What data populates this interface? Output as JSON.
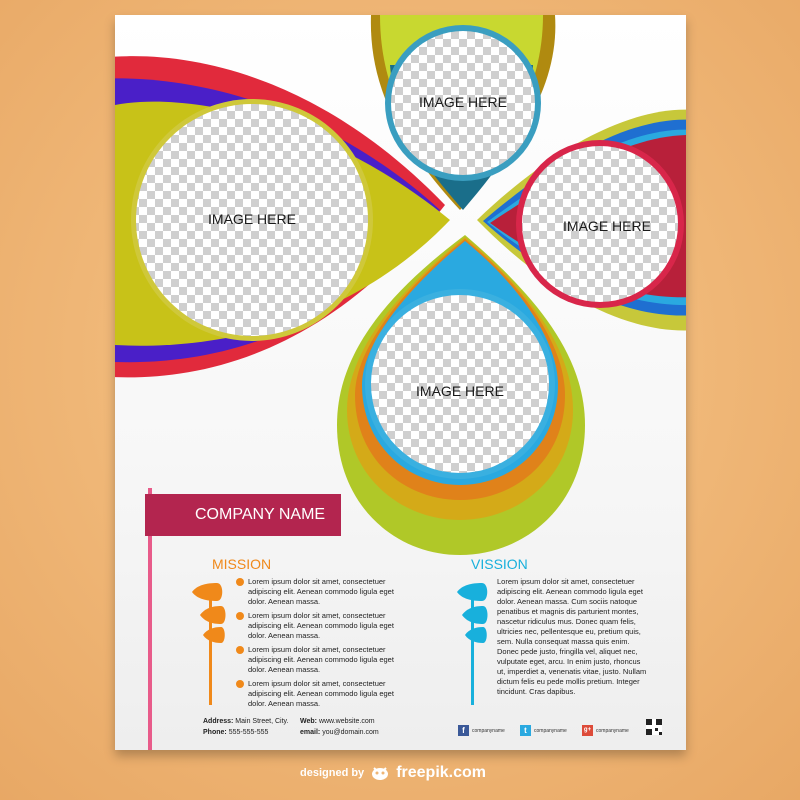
{
  "placeholders": {
    "left": "IMAGE HERE",
    "top": "IMAGE HERE",
    "right": "IMAGE HERE",
    "bottom": "IMAGE HERE"
  },
  "company": {
    "name": "COMPANY NAME"
  },
  "mission": {
    "title": "MISSION",
    "items": [
      "Lorem ipsum dolor sit amet, consectetuer adipiscing elit. Aenean commodo ligula eget dolor. Aenean massa.",
      "Lorem ipsum dolor sit amet, consectetuer adipiscing elit. Aenean commodo ligula eget dolor. Aenean massa.",
      "Lorem ipsum dolor sit amet, consectetuer adipiscing elit. Aenean commodo ligula eget dolor. Aenean massa.",
      "Lorem ipsum dolor sit amet, consectetuer adipiscing elit. Aenean commodo ligula eget dolor. Aenean massa."
    ]
  },
  "vission": {
    "title": "VISSION",
    "text": "Lorem ipsum dolor sit amet, consectetuer adipiscing elit. Aenean commodo ligula eget dolor. Aenean massa. Cum sociis natoque penatibus et magnis dis parturient montes, nascetur ridiculus mus. Donec quam felis, ultricies nec, pellentesque eu, pretium quis, sem. Nulla consequat massa quis enim. Donec pede justo, fringilla vel, aliquet nec, vulputate eget, arcu. In enim justo, rhoncus ut, imperdiet a, venenatis vitae, justo. Nullam dictum felis eu pede mollis pretium. Integer tincidunt. Cras dapibus."
  },
  "footer": {
    "address_label": "Address:",
    "address_value": "Main Street, City.",
    "phone_label": "Phone:",
    "phone_value": "555-555-555",
    "web_label": "Web:",
    "web_value": "www.website.com",
    "email_label": "email:",
    "email_value": "you@domain.com"
  },
  "social": [
    {
      "icon": "facebook-icon",
      "glyph": "f",
      "color": "#3b5998",
      "label": "companyname"
    },
    {
      "icon": "twitter-icon",
      "glyph": "t",
      "color": "#2aa9e0",
      "label": "companyname"
    },
    {
      "icon": "google-plus-icon",
      "glyph": "g+",
      "color": "#dd4b39",
      "label": "companyname"
    }
  ],
  "credit": {
    "prefix": "designed by",
    "brand": "freepik.com"
  },
  "colors": {
    "company_tag": "#b3254f",
    "mission": "#f0891a",
    "vission": "#18b0dc",
    "accent_line": "#e85b8a"
  }
}
